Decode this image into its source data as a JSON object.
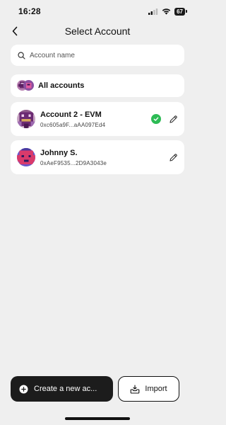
{
  "status": {
    "time": "16:28",
    "battery": "67"
  },
  "header": {
    "title": "Select Account"
  },
  "search": {
    "placeholder": "Account name"
  },
  "all_accounts": {
    "label": "All accounts"
  },
  "accounts": [
    {
      "name": "Account 2 - EVM",
      "address": "0xc605a9F...aAA097Ed4",
      "selected": true
    },
    {
      "name": "Johnny S.",
      "address": "0xAeF9535...2D9A3043e",
      "selected": false
    }
  ],
  "buttons": {
    "create": "Create a new ac...",
    "import": "Import"
  },
  "colors": {
    "accent_green": "#2dbb55",
    "dark_button": "#1c1c1c",
    "background": "#efefef"
  }
}
